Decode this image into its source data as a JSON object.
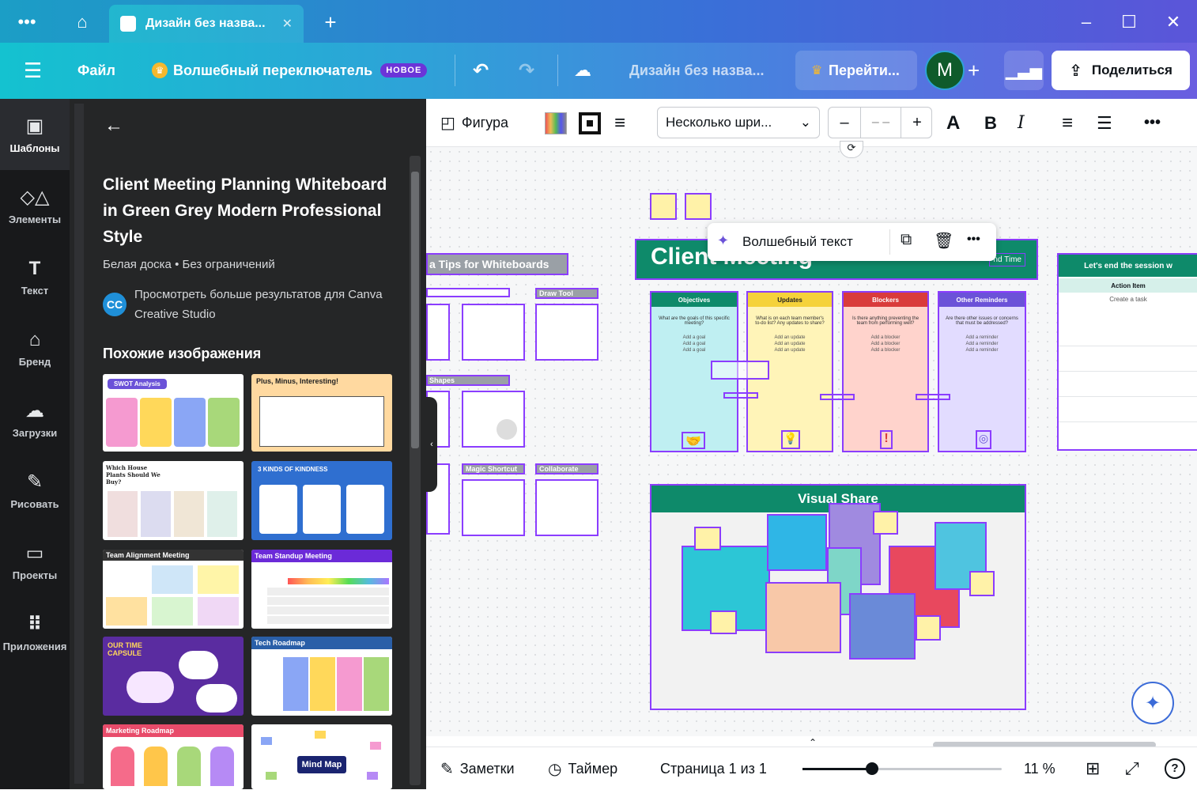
{
  "titlebar": {
    "tab_title": "Дизайн без назва...",
    "new_tab": "+",
    "menu": "•••",
    "tab_close": "✕"
  },
  "toolbar": {
    "file": "Файл",
    "magic_switch": "Волшебный переключатель",
    "new_badge": "НОВОЕ",
    "design_title": "Дизайн без назва...",
    "go_pro": "Перейти...",
    "avatar": "М",
    "share": "Поделиться"
  },
  "rail": [
    {
      "label": "Шаблоны",
      "icon": "templates-icon"
    },
    {
      "label": "Элементы",
      "icon": "elements-icon"
    },
    {
      "label": "Текст",
      "icon": "text-icon"
    },
    {
      "label": "Бренд",
      "icon": "brand-icon"
    },
    {
      "label": "Загрузки",
      "icon": "uploads-icon"
    },
    {
      "label": "Рисовать",
      "icon": "draw-icon"
    },
    {
      "label": "Проекты",
      "icon": "projects-icon"
    },
    {
      "label": "Приложения",
      "icon": "apps-icon"
    }
  ],
  "panel": {
    "title": "Client Meeting Planning Whiteboard in Green Grey Modern Professional Style",
    "meta": "Белая доска • Без ограничений",
    "creator_initials": "CC",
    "more_results": "Просмотреть больше результатов для Canva Creative Studio",
    "similar_heading": "Похожие изображения",
    "thumbs": [
      {
        "label": "SWOT Analysis",
        "bg": "#ffffff"
      },
      {
        "label": "Plus, Minus, Interesting!",
        "bg": "#ffd9a0"
      },
      {
        "label": "Which House Plants Should We Buy?",
        "bg": "#ffffff"
      },
      {
        "label": "3 KINDS OF KINDNESS",
        "bg": "#2f6fd0"
      },
      {
        "label": "Team Alignment Meeting",
        "bg": "#ffffff"
      },
      {
        "label": "Team Standup Meeting",
        "bg": "#ffffff"
      },
      {
        "label": "OUR TIME CAPSULE",
        "bg": "#5a2ca0"
      },
      {
        "label": "Tech Roadmap",
        "bg": "#ffffff"
      },
      {
        "label": "Marketing Roadmap",
        "bg": "#ffffff"
      },
      {
        "label": "Mind Map",
        "bg": "#ffffff"
      }
    ]
  },
  "context_toolbar": {
    "shape": "Фигура",
    "font": "Несколько шри...",
    "font_size": "– –",
    "minus": "–",
    "plus": "+",
    "bold": "B",
    "italic": "I",
    "more": "•••"
  },
  "canvas": {
    "magic_text": "Волшебный текст",
    "board_title": "Client Meeting",
    "end_time": "nd Time",
    "tips": "a Tips for Whiteboards",
    "draw_tool": "Draw Tool",
    "shapes": "Shapes",
    "magic_shortcut": "Magic Shortcut",
    "collaborate": "Collaborate",
    "columns": [
      {
        "title": "Objectives",
        "color": "#0e8a6a",
        "bg": "#bfeff2",
        "prompt": "What are the goals of this specific meeting?",
        "items": [
          "Add a goal",
          "Add a goal",
          "Add a goal"
        ]
      },
      {
        "title": "Updates",
        "color": "#f5d23a",
        "bg": "#fff4b8",
        "prompt": "What is on each team member's to-do list? Any updates to share?",
        "items": [
          "Add an update",
          "Add an update",
          "Add an update"
        ]
      },
      {
        "title": "Blockers",
        "color": "#d93b3b",
        "bg": "#ffd3cc",
        "prompt": "Is there anything preventing the team from performing well?",
        "items": [
          "Add a blocker",
          "Add a blocker",
          "Add a blocker"
        ]
      },
      {
        "title": "Other Reminders",
        "color": "#6b52d8",
        "bg": "#e2dcff",
        "prompt": "Are there other issues or concerns that must be addressed?",
        "items": [
          "Add a reminder",
          "Add a reminder",
          "Add a reminder"
        ]
      }
    ],
    "session_title": "Let's end the session w",
    "action_item": "Action Item",
    "create_task": "Create a task",
    "visual_share": "Visual Share"
  },
  "bottombar": {
    "notes": "Заметки",
    "timer": "Таймер",
    "page": "Страница 1 из 1",
    "zoom": "11 %",
    "zoom_fraction": 0.35
  }
}
